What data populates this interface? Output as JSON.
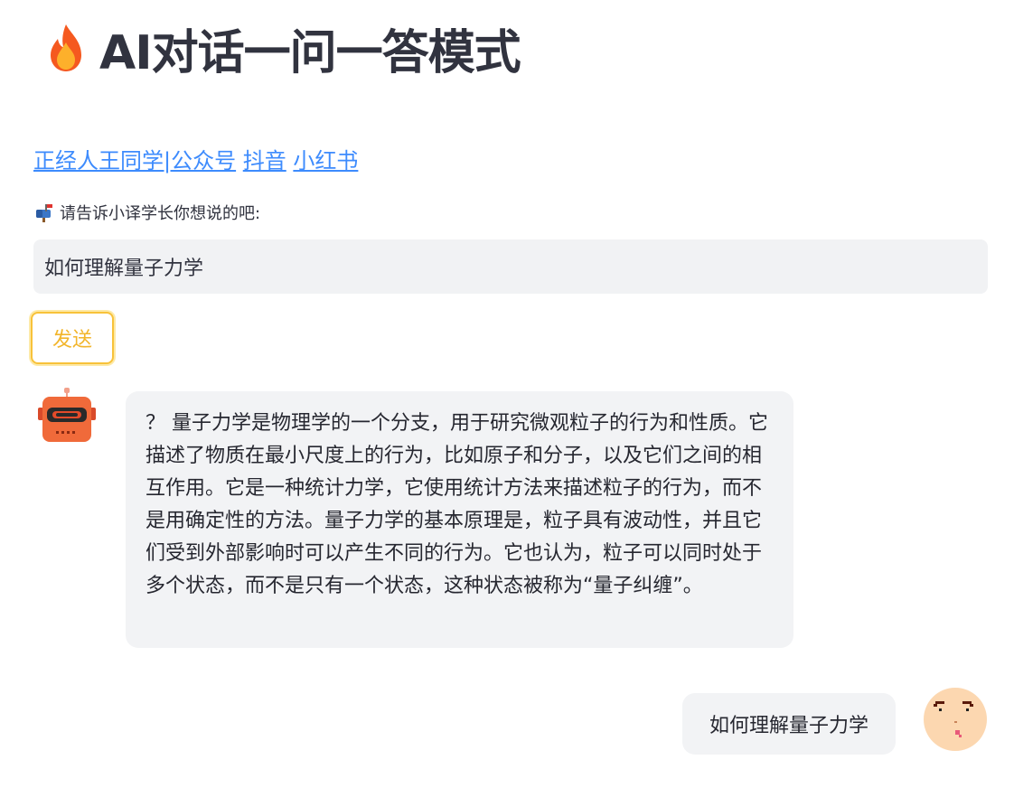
{
  "header": {
    "title": "AI对话一问一答模式",
    "icon": "fire-icon"
  },
  "links": {
    "items": [
      {
        "label": "正经人王同学|公众号"
      },
      {
        "label": "抖音"
      },
      {
        "label": "小红书"
      }
    ]
  },
  "prompt": {
    "label": "请告诉小译学长你想说的吧:",
    "icon": "mailbox-icon"
  },
  "input": {
    "value": "如何理解量子力学"
  },
  "send_button": {
    "label": "发送"
  },
  "messages": [
    {
      "role": "bot",
      "avatar": "robot-avatar",
      "text": "？ 量子力学是物理学的一个分支，用于研究微观粒子的行为和性质。它描述了物质在最小尺度上的行为，比如原子和分子，以及它们之间的相互作用。它是一种统计力学，它使用统计方法来描述粒子的行为，而不是用确定性的方法。量子力学的基本原理是，粒子具有波动性，并且它们受到外部影响时可以产生不同的行为。它也认为，粒子可以同时处于多个状态，而不是只有一个状态，这种状态被称为“量子纠缠”。"
    },
    {
      "role": "user",
      "avatar": "pixel-face-avatar",
      "text": "如何理解量子力学"
    }
  ],
  "colors": {
    "link": "#3d8bfd",
    "button_border": "#f8c23a",
    "button_text": "#f2b52b",
    "bubble_bg": "#f2f3f5",
    "input_bg": "#f1f2f4"
  }
}
